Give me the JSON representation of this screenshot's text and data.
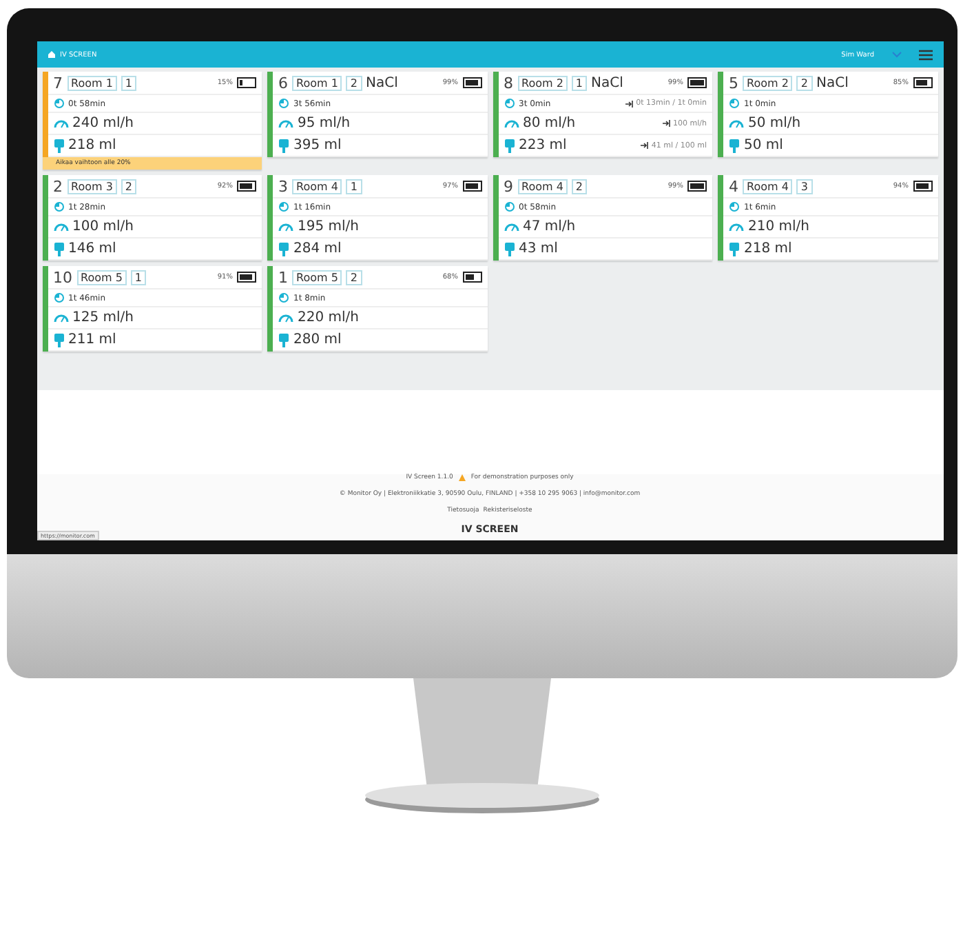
{
  "header": {
    "title": "IV SCREEN",
    "ward": "Sim Ward"
  },
  "pumps": [
    {
      "number": "7",
      "room": "Room 1",
      "bed": "1",
      "battery_text": "15%",
      "color": "#f5a623",
      "time": "0t 58min",
      "rate": "240 ml/h",
      "volume": "218 ml",
      "alert": "Aikaa vaihtoon alle 20%"
    },
    {
      "number": "6",
      "room": "Room 1",
      "bed": "2",
      "drug": "NaCl",
      "battery_text": "99%",
      "color": "#4caf50",
      "time": "3t 56min",
      "rate": "95 ml/h",
      "volume": "395 ml"
    },
    {
      "number": "8",
      "room": "Room 2",
      "bed": "1",
      "drug": "NaCl",
      "battery_text": "99%",
      "color": "#4caf50",
      "time": "3t 0min",
      "rate": "80 ml/h",
      "volume": "223 ml",
      "time_target": "0t 13min / 1t 0min",
      "rate_target": "100 ml/h",
      "volume_target": "41 ml / 100 ml"
    },
    {
      "number": "5",
      "room": "Room 2",
      "bed": "2",
      "drug": "NaCl",
      "battery_text": "85%",
      "color": "#4caf50",
      "time": "1t 0min",
      "rate": "50 ml/h",
      "volume": "50 ml"
    },
    {
      "number": "2",
      "room": "Room 3",
      "bed": "2",
      "battery_text": "92%",
      "color": "#4caf50",
      "time": "1t 28min",
      "rate": "100 ml/h",
      "volume": "146 ml"
    },
    {
      "number": "3",
      "room": "Room 4",
      "bed": "1",
      "battery_text": "97%",
      "color": "#4caf50",
      "time": "1t 16min",
      "rate": "195 ml/h",
      "volume": "284 ml"
    },
    {
      "number": "9",
      "room": "Room 4",
      "bed": "2",
      "battery_text": "99%",
      "color": "#4caf50",
      "time": "0t 58min",
      "rate": "47 ml/h",
      "volume": "43 ml"
    },
    {
      "number": "4",
      "room": "Room 4",
      "bed": "3",
      "battery_text": "94%",
      "color": "#4caf50",
      "time": "1t 6min",
      "rate": "210 ml/h",
      "volume": "218 ml"
    },
    {
      "number": "10",
      "room": "Room 5",
      "bed": "1",
      "battery_text": "91%",
      "color": "#4caf50",
      "time": "1t 46min",
      "rate": "125 ml/h",
      "volume": "211 ml"
    },
    {
      "number": "1",
      "room": "Room 5",
      "bed": "2",
      "battery_text": "68%",
      "color": "#4caf50",
      "time": "1t 8min",
      "rate": "220 ml/h",
      "volume": "280 ml"
    }
  ],
  "footer": {
    "version": "IV Screen 1.1.0",
    "notice": "For demonstration purposes only",
    "contact": "© Monitor Oy | Elektroniikkatie 3, 90590 Oulu, FINLAND | +358 10 295 9063 | info@monitor.com",
    "links": [
      "Tietosuoja",
      "Rekisteriseloste"
    ],
    "brand": "IV SCREEN"
  },
  "status_url": "https://monitor.com"
}
